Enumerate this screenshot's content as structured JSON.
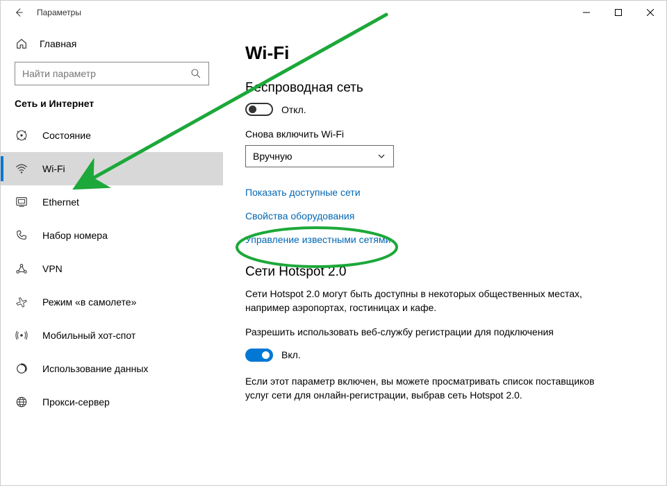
{
  "window": {
    "title": "Параметры"
  },
  "sidebar": {
    "home": "Главная",
    "search_placeholder": "Найти параметр",
    "category": "Сеть и Интернет",
    "items": [
      {
        "label": "Состояние",
        "icon": "status-icon",
        "selected": false
      },
      {
        "label": "Wi-Fi",
        "icon": "wifi-icon",
        "selected": true
      },
      {
        "label": "Ethernet",
        "icon": "ethernet-icon",
        "selected": false
      },
      {
        "label": "Набор номера",
        "icon": "dialup-icon",
        "selected": false
      },
      {
        "label": "VPN",
        "icon": "vpn-icon",
        "selected": false
      },
      {
        "label": "Режим «в самолете»",
        "icon": "airplane-icon",
        "selected": false
      },
      {
        "label": "Мобильный хот-спот",
        "icon": "hotspot-icon",
        "selected": false
      },
      {
        "label": "Использование данных",
        "icon": "data-usage-icon",
        "selected": false
      },
      {
        "label": "Прокси-сервер",
        "icon": "proxy-icon",
        "selected": false
      }
    ]
  },
  "main": {
    "heading": "Wi-Fi",
    "wireless": {
      "title": "Беспроводная сеть",
      "toggle_state": "off",
      "toggle_label": "Откл.",
      "reenable_label": "Снова включить Wi-Fi",
      "dropdown_value": "Вручную"
    },
    "links": {
      "available_networks": "Показать доступные сети",
      "hardware_props": "Свойства оборудования",
      "known_networks": "Управление известными сетями"
    },
    "hotspot": {
      "title": "Сети Hotspot 2.0",
      "desc": "Сети Hotspot 2.0 могут быть доступны в некоторых общественных местах, например аэропортах, гостиницах и кафе.",
      "allow_label": "Разрешить использовать веб-службу регистрации для подключения",
      "toggle_state": "on",
      "toggle_label": "Вкл.",
      "note": "Если этот параметр включен, вы можете просматривать список поставщиков услуг сети для онлайн-регистрации, выбрав сеть Hotspot 2.0."
    }
  },
  "annotations": {
    "arrow_color": "#1ca83a",
    "circle_color": "#1ca83a"
  }
}
